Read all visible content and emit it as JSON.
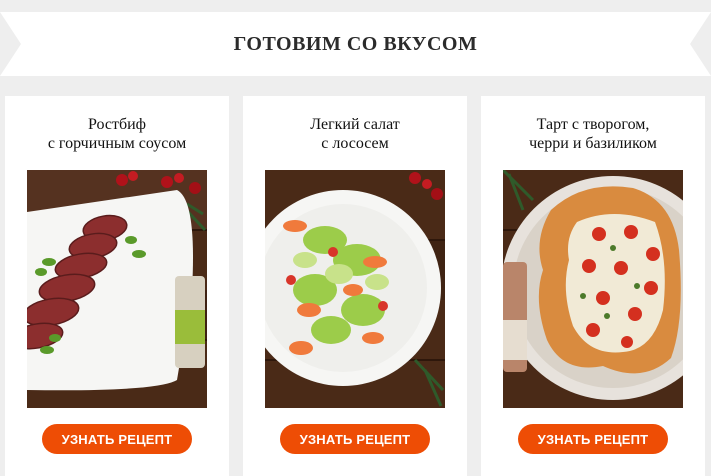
{
  "banner": {
    "title": "ГОТОВИМ СО ВКУСОМ"
  },
  "colors": {
    "accent": "#ee4d05",
    "background": "#eeeeee",
    "card": "#ffffff"
  },
  "recipes": [
    {
      "title": "Ростбиф\nс горчичным соусом",
      "button_label": "УЗНАТЬ РЕЦЕПТ",
      "photo": "roast-beef-photo"
    },
    {
      "title": "Легкий салат\nс лососем",
      "button_label": "УЗНАТЬ РЕЦЕПТ",
      "photo": "salmon-salad-photo"
    },
    {
      "title": "Тарт с творогом,\nчерри и базиликом",
      "button_label": "УЗНАТЬ РЕЦЕПТ",
      "photo": "cottage-cheese-tart-photo"
    }
  ]
}
